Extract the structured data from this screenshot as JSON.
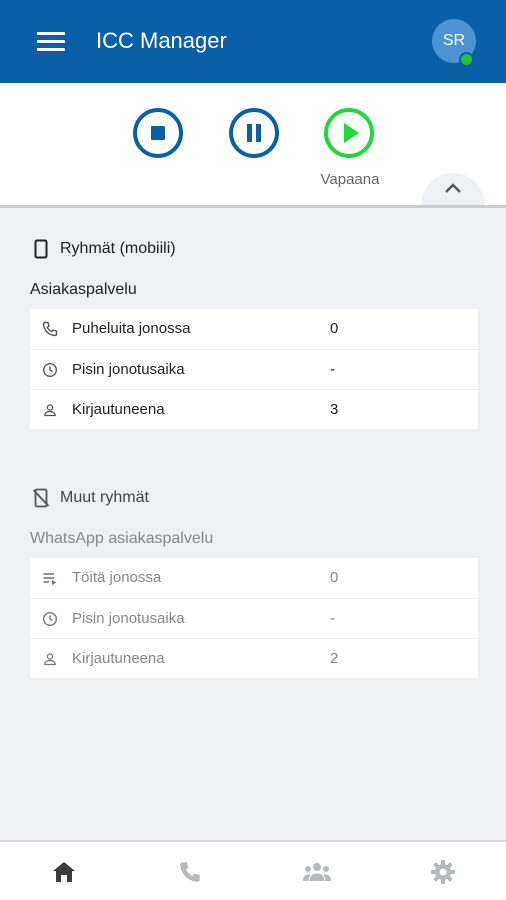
{
  "app": {
    "title": "ICC Manager",
    "avatar_initials": "SR",
    "presence_color": "#22c33b",
    "brand_color": "#0a5fa8"
  },
  "controls": {
    "stop_icon": "stop-circle-icon",
    "pause_icon": "pause-circle-icon",
    "play_icon": "play-circle-icon",
    "status_text": "Vapaana"
  },
  "mobile_groups": {
    "heading": "Ryhmät (mobiili)",
    "icon": "smartphone-icon",
    "group_name": "Asiakaspalvelu",
    "rows": [
      {
        "icon": "phone-icon",
        "label": "Puheluita jonossa",
        "value": "0"
      },
      {
        "icon": "clock-icon",
        "label": "Pisin jonotusaika",
        "value": "-"
      },
      {
        "icon": "person-icon",
        "label": "Kirjautuneena",
        "value": "3"
      }
    ]
  },
  "other_groups": {
    "heading": "Muut ryhmät",
    "icon": "mobile-off-icon",
    "group_name": "WhatsApp asiakaspalvelu",
    "rows": [
      {
        "icon": "queue-list-icon",
        "label": "Töitä jonossa",
        "value": "0"
      },
      {
        "icon": "clock-icon",
        "label": "Pisin jonotusaika",
        "value": "-"
      },
      {
        "icon": "person-icon",
        "label": "Kirjautuneena",
        "value": "2"
      }
    ]
  },
  "bottom_nav": [
    {
      "name": "home",
      "icon": "home-icon",
      "active": true
    },
    {
      "name": "calls",
      "icon": "phone-icon",
      "active": false
    },
    {
      "name": "groups",
      "icon": "group-icon",
      "active": false
    },
    {
      "name": "settings",
      "icon": "gear-icon",
      "active": false
    }
  ]
}
